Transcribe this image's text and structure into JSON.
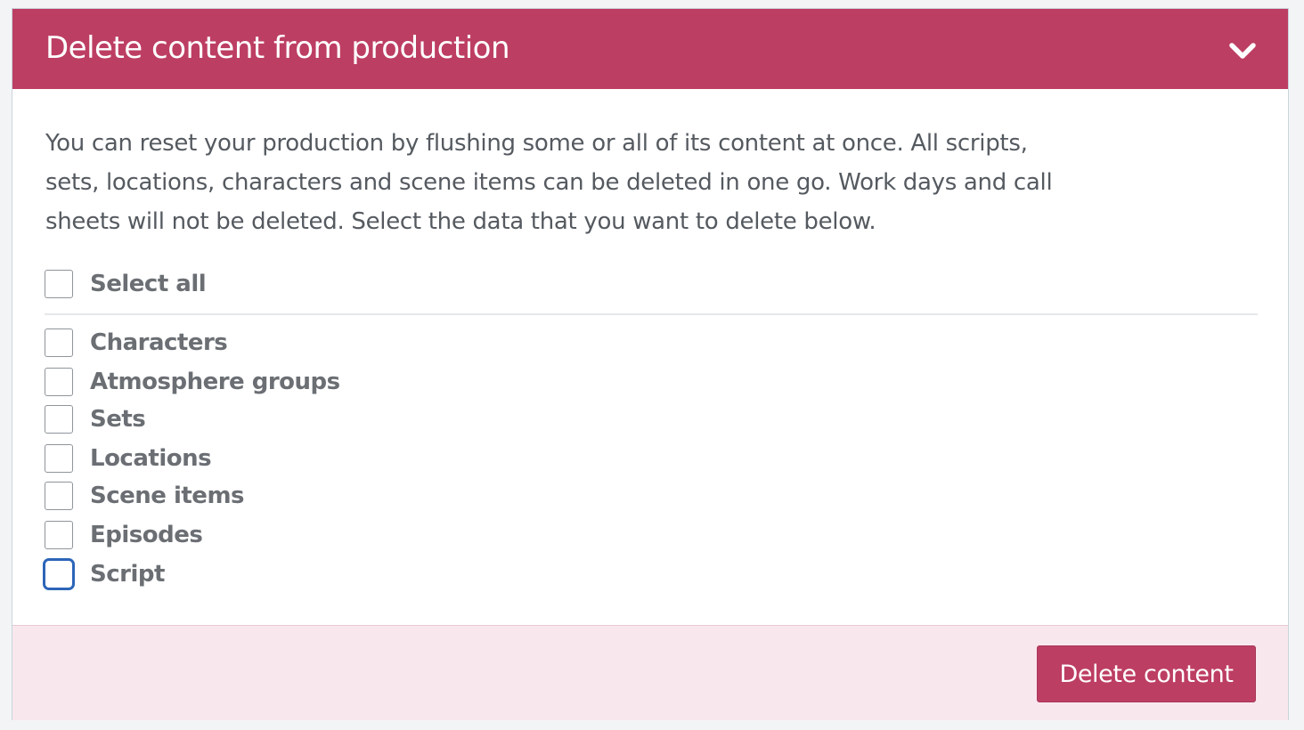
{
  "panel": {
    "title": "Delete content from production",
    "collapse_icon": "chevron-down-icon",
    "description": "You can reset your production by flushing some or all of its content at once. All scripts, sets, locations, characters and scene items can be deleted in one go. Work days and call sheets will not be deleted. Select the data that you want to delete below."
  },
  "select_all": {
    "label": "Select all",
    "checked": false
  },
  "options": [
    {
      "label": "Characters",
      "checked": false
    },
    {
      "label": "Atmosphere groups",
      "checked": false
    },
    {
      "label": "Sets",
      "checked": false
    },
    {
      "label": "Locations",
      "checked": false
    },
    {
      "label": "Scene items",
      "checked": false
    },
    {
      "label": "Episodes",
      "checked": false
    },
    {
      "label": "Script",
      "checked": false,
      "focused": true
    }
  ],
  "footer": {
    "delete_label": "Delete content"
  },
  "colors": {
    "accent": "#bd3e63",
    "footer_bg": "#f8e8ee",
    "text": "#555a60",
    "focus": "#2c65b8"
  }
}
